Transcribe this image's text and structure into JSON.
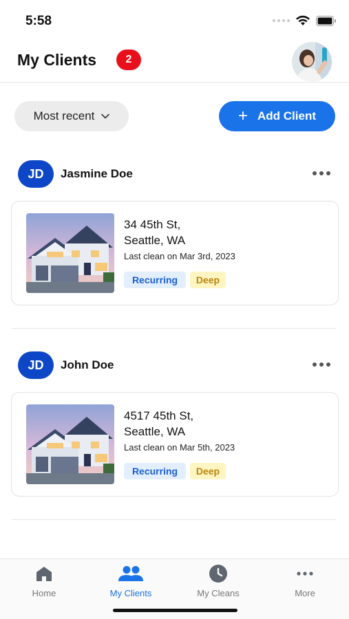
{
  "status_bar": {
    "time": "5:58"
  },
  "header": {
    "title": "My Clients",
    "badge_count": "2"
  },
  "toolbar": {
    "sort_label": "Most recent",
    "add_label": "Add Client",
    "add_symbol": "+"
  },
  "clients": [
    {
      "initials": "JD",
      "name": "Jasmine Doe",
      "property": {
        "address_line1": "34 45th St,",
        "address_line2": "Seattle, WA",
        "last_clean": "Last clean on Mar 3rd, 2023",
        "tags": [
          "Recurring",
          "Deep"
        ]
      }
    },
    {
      "initials": "JD",
      "name": "John Doe",
      "property": {
        "address_line1": "4517 45th St,",
        "address_line2": "Seattle, WA",
        "last_clean": "Last clean on Mar 5th, 2023",
        "tags": [
          "Recurring",
          "Deep"
        ]
      }
    }
  ],
  "tab_bar": {
    "tabs": [
      {
        "label": "Home",
        "icon": "home-icon",
        "active": false
      },
      {
        "label": "My Clients",
        "icon": "people-icon",
        "active": true
      },
      {
        "label": "My Cleans",
        "icon": "clock-icon",
        "active": false
      },
      {
        "label": "More",
        "icon": "more-icon",
        "active": false
      }
    ]
  },
  "colors": {
    "accent": "#1a73e8",
    "badge": "#e8101a",
    "initials_bg": "#0d47c7",
    "tag_recurring_bg": "#e3efff",
    "tag_deep_bg": "#fff5c2"
  }
}
